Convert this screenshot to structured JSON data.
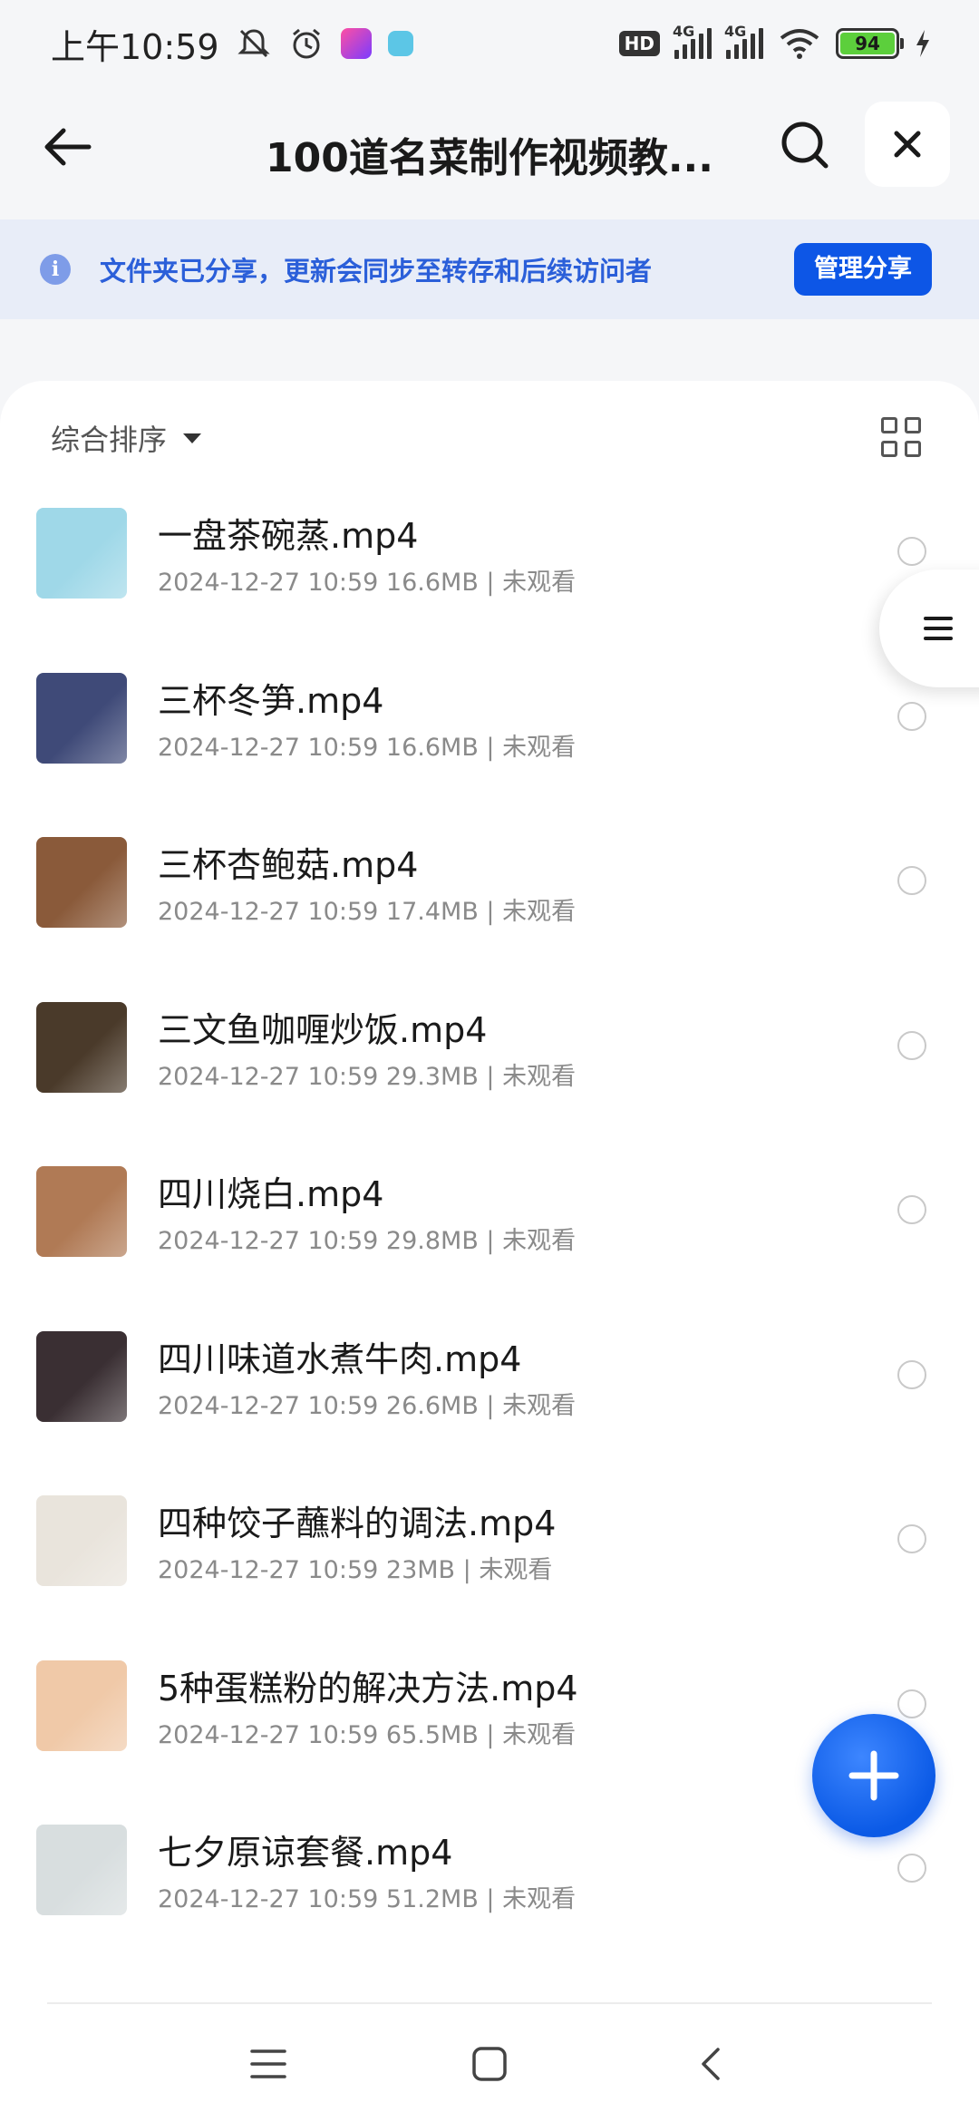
{
  "status_bar": {
    "time": "上午10:59",
    "battery": "94",
    "network_1": "4G",
    "network_2": "4G",
    "hd": "HD"
  },
  "header": {
    "title": "100道名菜制作视频教...",
    "back_icon": "arrow-left-icon",
    "search_icon": "search-icon",
    "close_icon": "close-icon"
  },
  "share_banner": {
    "text": "文件夹已分享，更新会同步至转存和后续访问者",
    "button": "管理分享",
    "accent": "#0d56e6"
  },
  "toolbar": {
    "sort_label": "综合排序"
  },
  "files": [
    {
      "name": "一盘茶碗蒸.mp4",
      "date": "2024-12-27 10:59",
      "size": "16.6MB",
      "status": "未观看",
      "thumb": "#9fd8e8"
    },
    {
      "name": "三杯冬笋.mp4",
      "date": "2024-12-27 10:59",
      "size": "16.6MB",
      "status": "未观看",
      "thumb": "#3f4a78"
    },
    {
      "name": "三杯杏鲍菇.mp4",
      "date": "2024-12-27 10:59",
      "size": "17.4MB",
      "status": "未观看",
      "thumb": "#8a5a3a"
    },
    {
      "name": "三文鱼咖喱炒饭.mp4",
      "date": "2024-12-27 10:59",
      "size": "29.3MB",
      "status": "未观看",
      "thumb": "#4a3a2a"
    },
    {
      "name": "四川烧白.mp4",
      "date": "2024-12-27 10:59",
      "size": "29.8MB",
      "status": "未观看",
      "thumb": "#b07a55"
    },
    {
      "name": "四川味道水煮牛肉.mp4",
      "date": "2024-12-27 10:59",
      "size": "26.6MB",
      "status": "未观看",
      "thumb": "#3a2f33"
    },
    {
      "name": "四种饺子蘸料的调法.mp4",
      "date": "2024-12-27 10:59",
      "size": "23MB",
      "status": "未观看",
      "thumb": "#e9e4dc"
    },
    {
      "name": "5种蛋糕粉的解决方法.mp4",
      "date": "2024-12-27 10:59",
      "size": "65.5MB",
      "status": "未观看",
      "thumb": "#f0c9a8"
    },
    {
      "name": "七夕原谅套餐.mp4",
      "date": "2024-12-27 10:59",
      "size": "51.2MB",
      "status": "未观看",
      "thumb": "#d8dedf"
    }
  ],
  "fab_icon": "plus-icon"
}
